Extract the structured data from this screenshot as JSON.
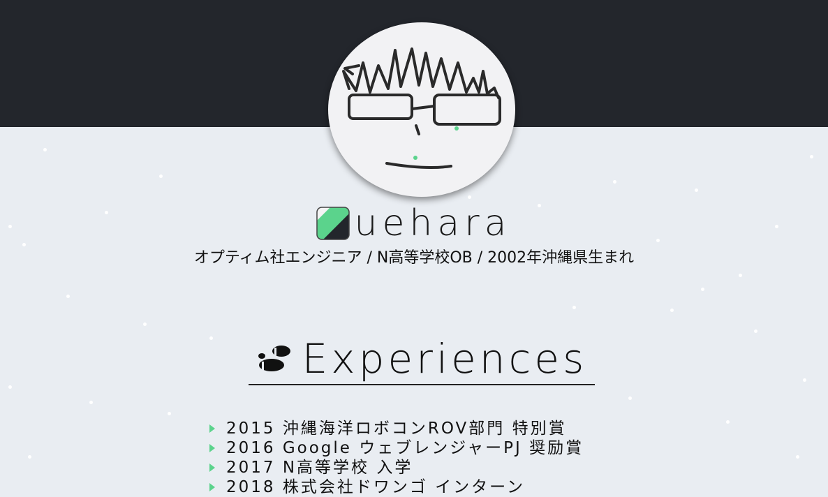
{
  "profile": {
    "name": "uehara",
    "tagline": "オプティム社エンジニア / N高等学校OB / 2002年沖縄県生まれ"
  },
  "experiences": {
    "heading": "Experiences",
    "items": [
      "2015 沖縄海洋ロボコンROV部門 特別賞",
      "2016 Google ウェブレンジャーPJ 奨励賞",
      "2017 N高等学校 入学",
      "2018 株式会社ドワンゴ インターン"
    ]
  },
  "colors": {
    "header": "#23262c",
    "background": "#e9edf2",
    "accent": "#5bd38c"
  },
  "icons": {
    "logo": "green-black-square-logo-icon",
    "section": "footprints-icon",
    "bullet": "triangle-bullet-icon"
  }
}
